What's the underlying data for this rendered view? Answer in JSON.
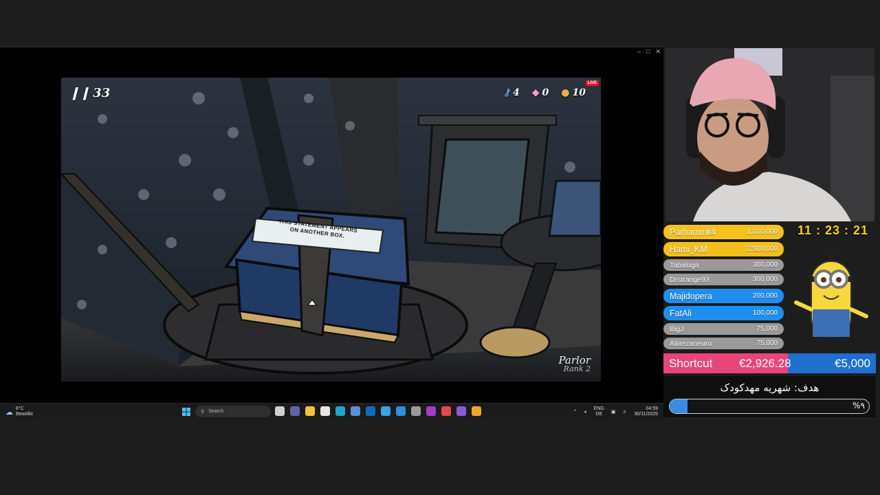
{
  "game": {
    "steps": "33",
    "keys": "4",
    "gems": "0",
    "coins": "10",
    "live_label": "LIVE",
    "box_text_line1": "THIS STATEMENT APPEARS",
    "box_text_line2": "ON ANOTHER BOX.",
    "room_name": "Parlor",
    "room_rank": "Rank 2"
  },
  "taskbar": {
    "temperature": "8°C",
    "weather_desc": "Bewölkt",
    "search_placeholder": "Search",
    "lang": "ENG",
    "layout": "DE",
    "time": "04:59",
    "date": "30/11/2025",
    "app_icons": [
      {
        "name": "task-view-icon",
        "color": "#d0d0d0"
      },
      {
        "name": "teams-icon",
        "color": "#6264a7"
      },
      {
        "name": "file-explorer-icon",
        "color": "#f3c13a"
      },
      {
        "name": "store-icon",
        "color": "#e6e6e6"
      },
      {
        "name": "edge-icon",
        "color": "#1fa6c9"
      },
      {
        "name": "app-icon-1",
        "color": "#5a8fd8"
      },
      {
        "name": "outlook-icon",
        "color": "#0f6cbd"
      },
      {
        "name": "app-icon-2",
        "color": "#3aa4e0"
      },
      {
        "name": "vscode-icon",
        "color": "#2d8fe0"
      },
      {
        "name": "terminal-icon",
        "color": "#9a9a9a"
      },
      {
        "name": "rider-icon",
        "color": "#a33dc7"
      },
      {
        "name": "app-icon-3",
        "color": "#e04a4a"
      },
      {
        "name": "app-icon-4",
        "color": "#8a5bd6"
      },
      {
        "name": "chrome-icon",
        "color": "#e8a82d"
      }
    ]
  },
  "overlay": {
    "timer": "11 : 23 : 21",
    "leaderboard": [
      {
        "name": "Parhammk4",
        "amount": "1,000,000",
        "color": "#f5c21c"
      },
      {
        "name": "Hami_KM",
        "amount": "2,500,000",
        "color": "#f2bf1c"
      },
      {
        "name": "Tabaluga",
        "amount": "300,000",
        "color": "#9a9a9a"
      },
      {
        "name": "Drstrange93",
        "amount": "300,000",
        "color": "#9a9a9a"
      },
      {
        "name": "Majidopera",
        "amount": "200,000",
        "color": "#1e8ff0"
      },
      {
        "name": "FatAli",
        "amount": "100,000",
        "color": "#1e8ff0"
      },
      {
        "name": "BigJ",
        "amount": "75,000",
        "color": "#9a9a9a"
      },
      {
        "name": "Aliirezaneuro",
        "amount": "75,000",
        "color": "#9a9a9a"
      }
    ],
    "goal": {
      "label": "Shortcut",
      "current": "€2,926.28",
      "target": "€5,000",
      "progress": 0.585,
      "fill_color": "#e9457a",
      "track_color": "#1e6fd0"
    },
    "donation": {
      "title": "هدف: شهریه مهدکودک",
      "percent": "%٩",
      "progress": 0.09
    }
  }
}
